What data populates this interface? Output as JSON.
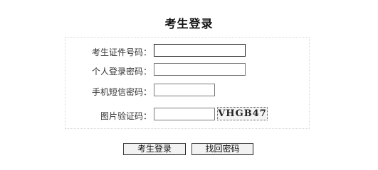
{
  "page": {
    "title": "考生登录"
  },
  "form": {
    "id_number": {
      "label": "考生证件号码：",
      "value": ""
    },
    "password": {
      "label": "个人登录密码：",
      "value": ""
    },
    "sms_code": {
      "label": "手机短信密码：",
      "value": ""
    },
    "captcha": {
      "label": "图片验证码：",
      "value": "",
      "image_text": "VHGB47"
    }
  },
  "buttons": {
    "login_label": "考生登录",
    "find_password_label": "找回密码"
  }
}
